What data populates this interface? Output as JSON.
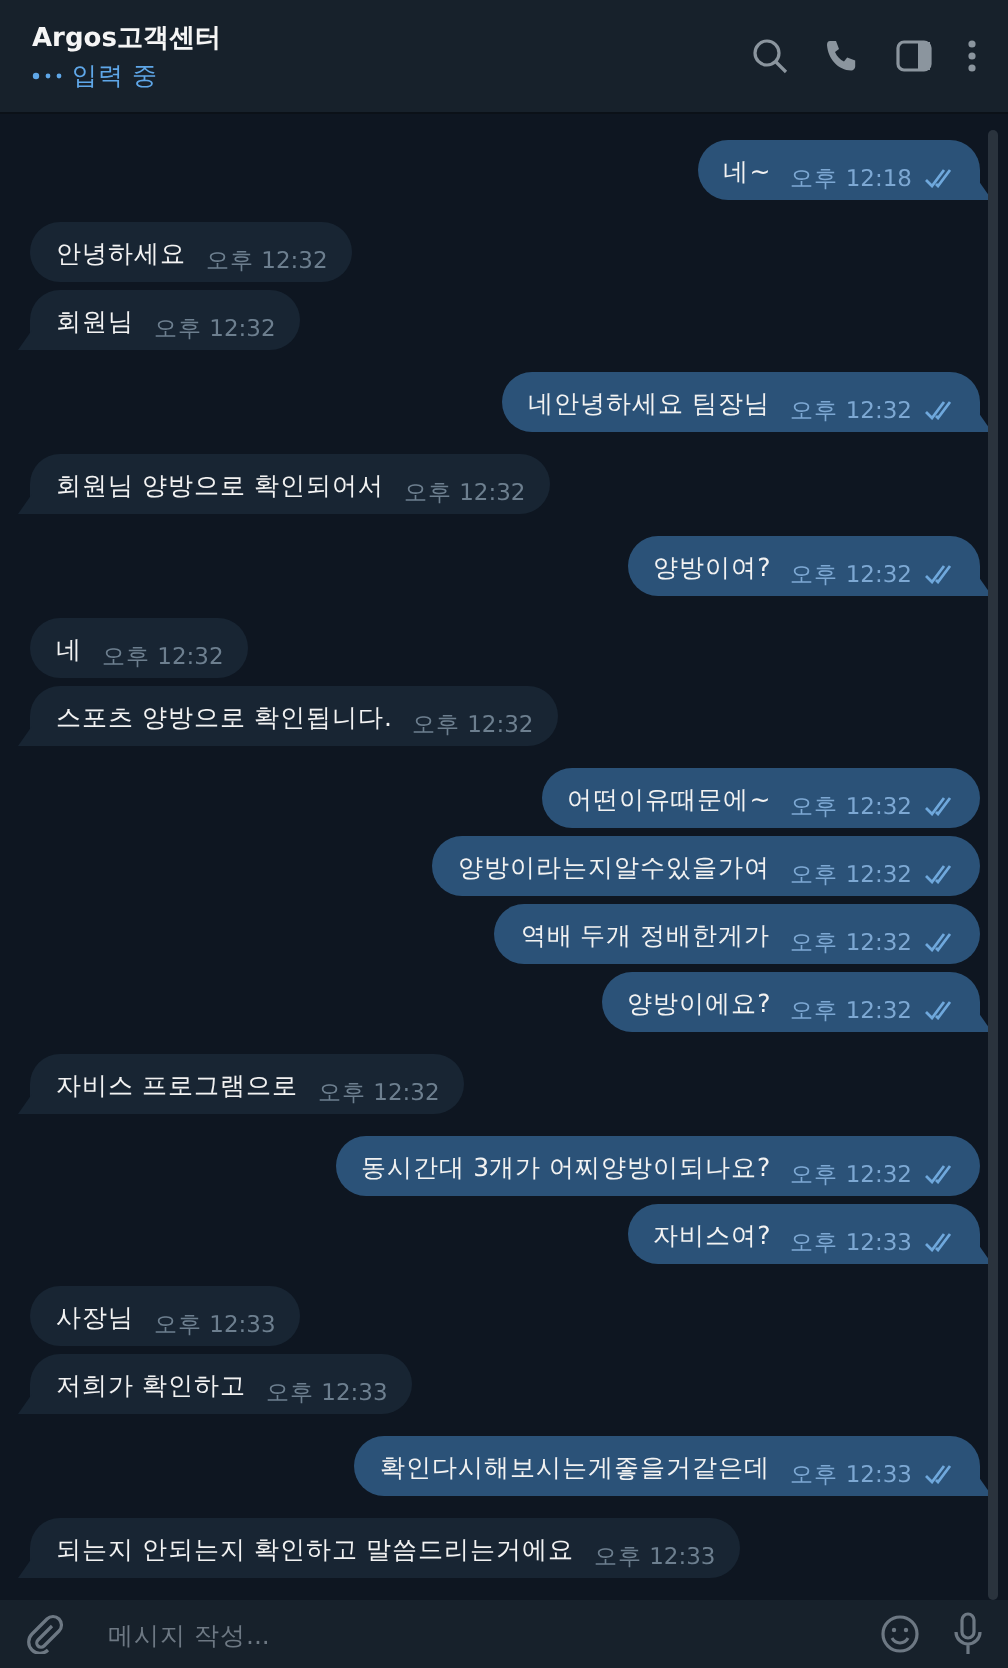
{
  "header": {
    "title": "Argos고객센터",
    "status": "입력 중"
  },
  "messages": [
    {
      "kind": "outgoing",
      "text": "네~",
      "time": "오후 12:18",
      "read": true,
      "tail": true
    },
    {
      "kind": "incoming",
      "text": "안녕하세요",
      "time": "오후 12:32",
      "tail": false
    },
    {
      "kind": "incoming",
      "text": "회원님",
      "time": "오후 12:32",
      "tail": true
    },
    {
      "kind": "outgoing",
      "text": "네안녕하세요 팀장님",
      "time": "오후 12:32",
      "read": true,
      "tail": true
    },
    {
      "kind": "incoming",
      "text": "회원님 양방으로 확인되어서",
      "time": "오후 12:32",
      "tail": true
    },
    {
      "kind": "outgoing",
      "text": "양방이여?",
      "time": "오후 12:32",
      "read": true,
      "tail": true
    },
    {
      "kind": "incoming",
      "text": "네",
      "time": "오후 12:32",
      "tail": false
    },
    {
      "kind": "incoming",
      "text": "스포츠 양방으로 확인됩니다.",
      "time": "오후 12:32",
      "tail": true
    },
    {
      "kind": "outgoing",
      "text": "어떤이유때문에~",
      "time": "오후 12:32",
      "read": true,
      "tail": false
    },
    {
      "kind": "outgoing",
      "text": "양방이라는지알수있을가여",
      "time": "오후 12:32",
      "read": true,
      "tail": false
    },
    {
      "kind": "outgoing",
      "text": "역배 두개 정배한게가",
      "time": "오후 12:32",
      "read": true,
      "tail": false
    },
    {
      "kind": "outgoing",
      "text": "양방이에요?",
      "time": "오후 12:32",
      "read": true,
      "tail": true
    },
    {
      "kind": "incoming",
      "text": "자비스 프로그램으로",
      "time": "오후 12:32",
      "tail": true
    },
    {
      "kind": "outgoing",
      "text": "동시간대 3개가 어찌양방이되나요?",
      "time": "오후 12:32",
      "read": true,
      "tail": false
    },
    {
      "kind": "outgoing",
      "text": "자비스여?",
      "time": "오후 12:33",
      "read": true,
      "tail": true
    },
    {
      "kind": "incoming",
      "text": "사장님",
      "time": "오후 12:33",
      "tail": false
    },
    {
      "kind": "incoming",
      "text": "저희가 확인하고",
      "time": "오후 12:33",
      "tail": true
    },
    {
      "kind": "outgoing",
      "text": "확인다시해보시는게좋을거같은데",
      "time": "오후 12:33",
      "read": true,
      "tail": true
    },
    {
      "kind": "incoming",
      "text": "되는지 안되는지 확인하고 말씀드리는거에요",
      "time": "오후 12:33",
      "tail": true
    }
  ],
  "composer": {
    "placeholder": "메시지 작성..."
  }
}
